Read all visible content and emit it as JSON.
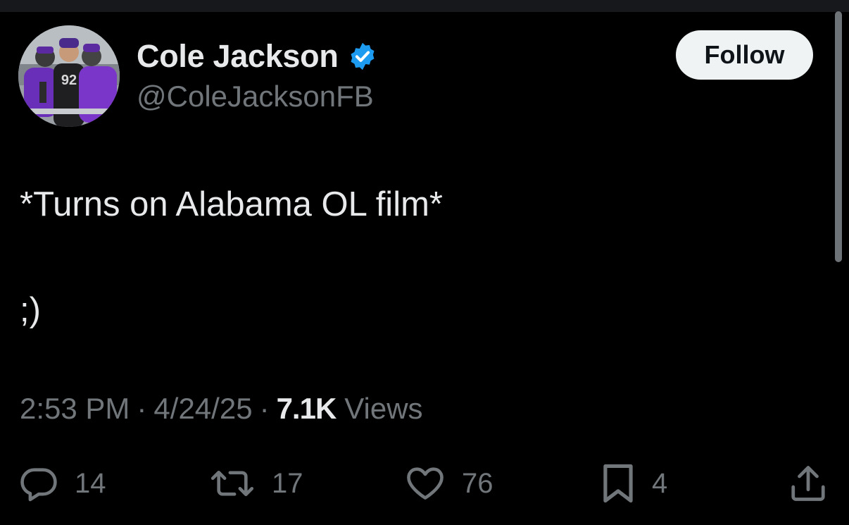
{
  "author": {
    "display_name": "Cole Jackson",
    "handle": "@ColeJacksonFB",
    "verified": true,
    "verified_color": "#1d9bf0",
    "avatar_jersey_text": "92"
  },
  "follow_button": {
    "label": "Follow"
  },
  "tweet": {
    "lines": [
      "*Turns on Alabama OL film*",
      ";)"
    ]
  },
  "meta": {
    "time": "2:53 PM",
    "separator": "·",
    "date": "4/24/25",
    "views_count": "7.1K",
    "views_label": "Views"
  },
  "actions": {
    "reply": {
      "icon": "reply-icon",
      "count": "14"
    },
    "retweet": {
      "icon": "retweet-icon",
      "count": "17"
    },
    "like": {
      "icon": "heart-icon",
      "count": "76"
    },
    "bookmark": {
      "icon": "bookmark-icon",
      "count": "4"
    },
    "share": {
      "icon": "share-icon"
    }
  },
  "colors": {
    "background": "#000000",
    "text_primary": "#e7e9ea",
    "text_secondary": "#71767b",
    "follow_bg": "#eff3f4",
    "accent_purple": "#6a2fb8"
  }
}
